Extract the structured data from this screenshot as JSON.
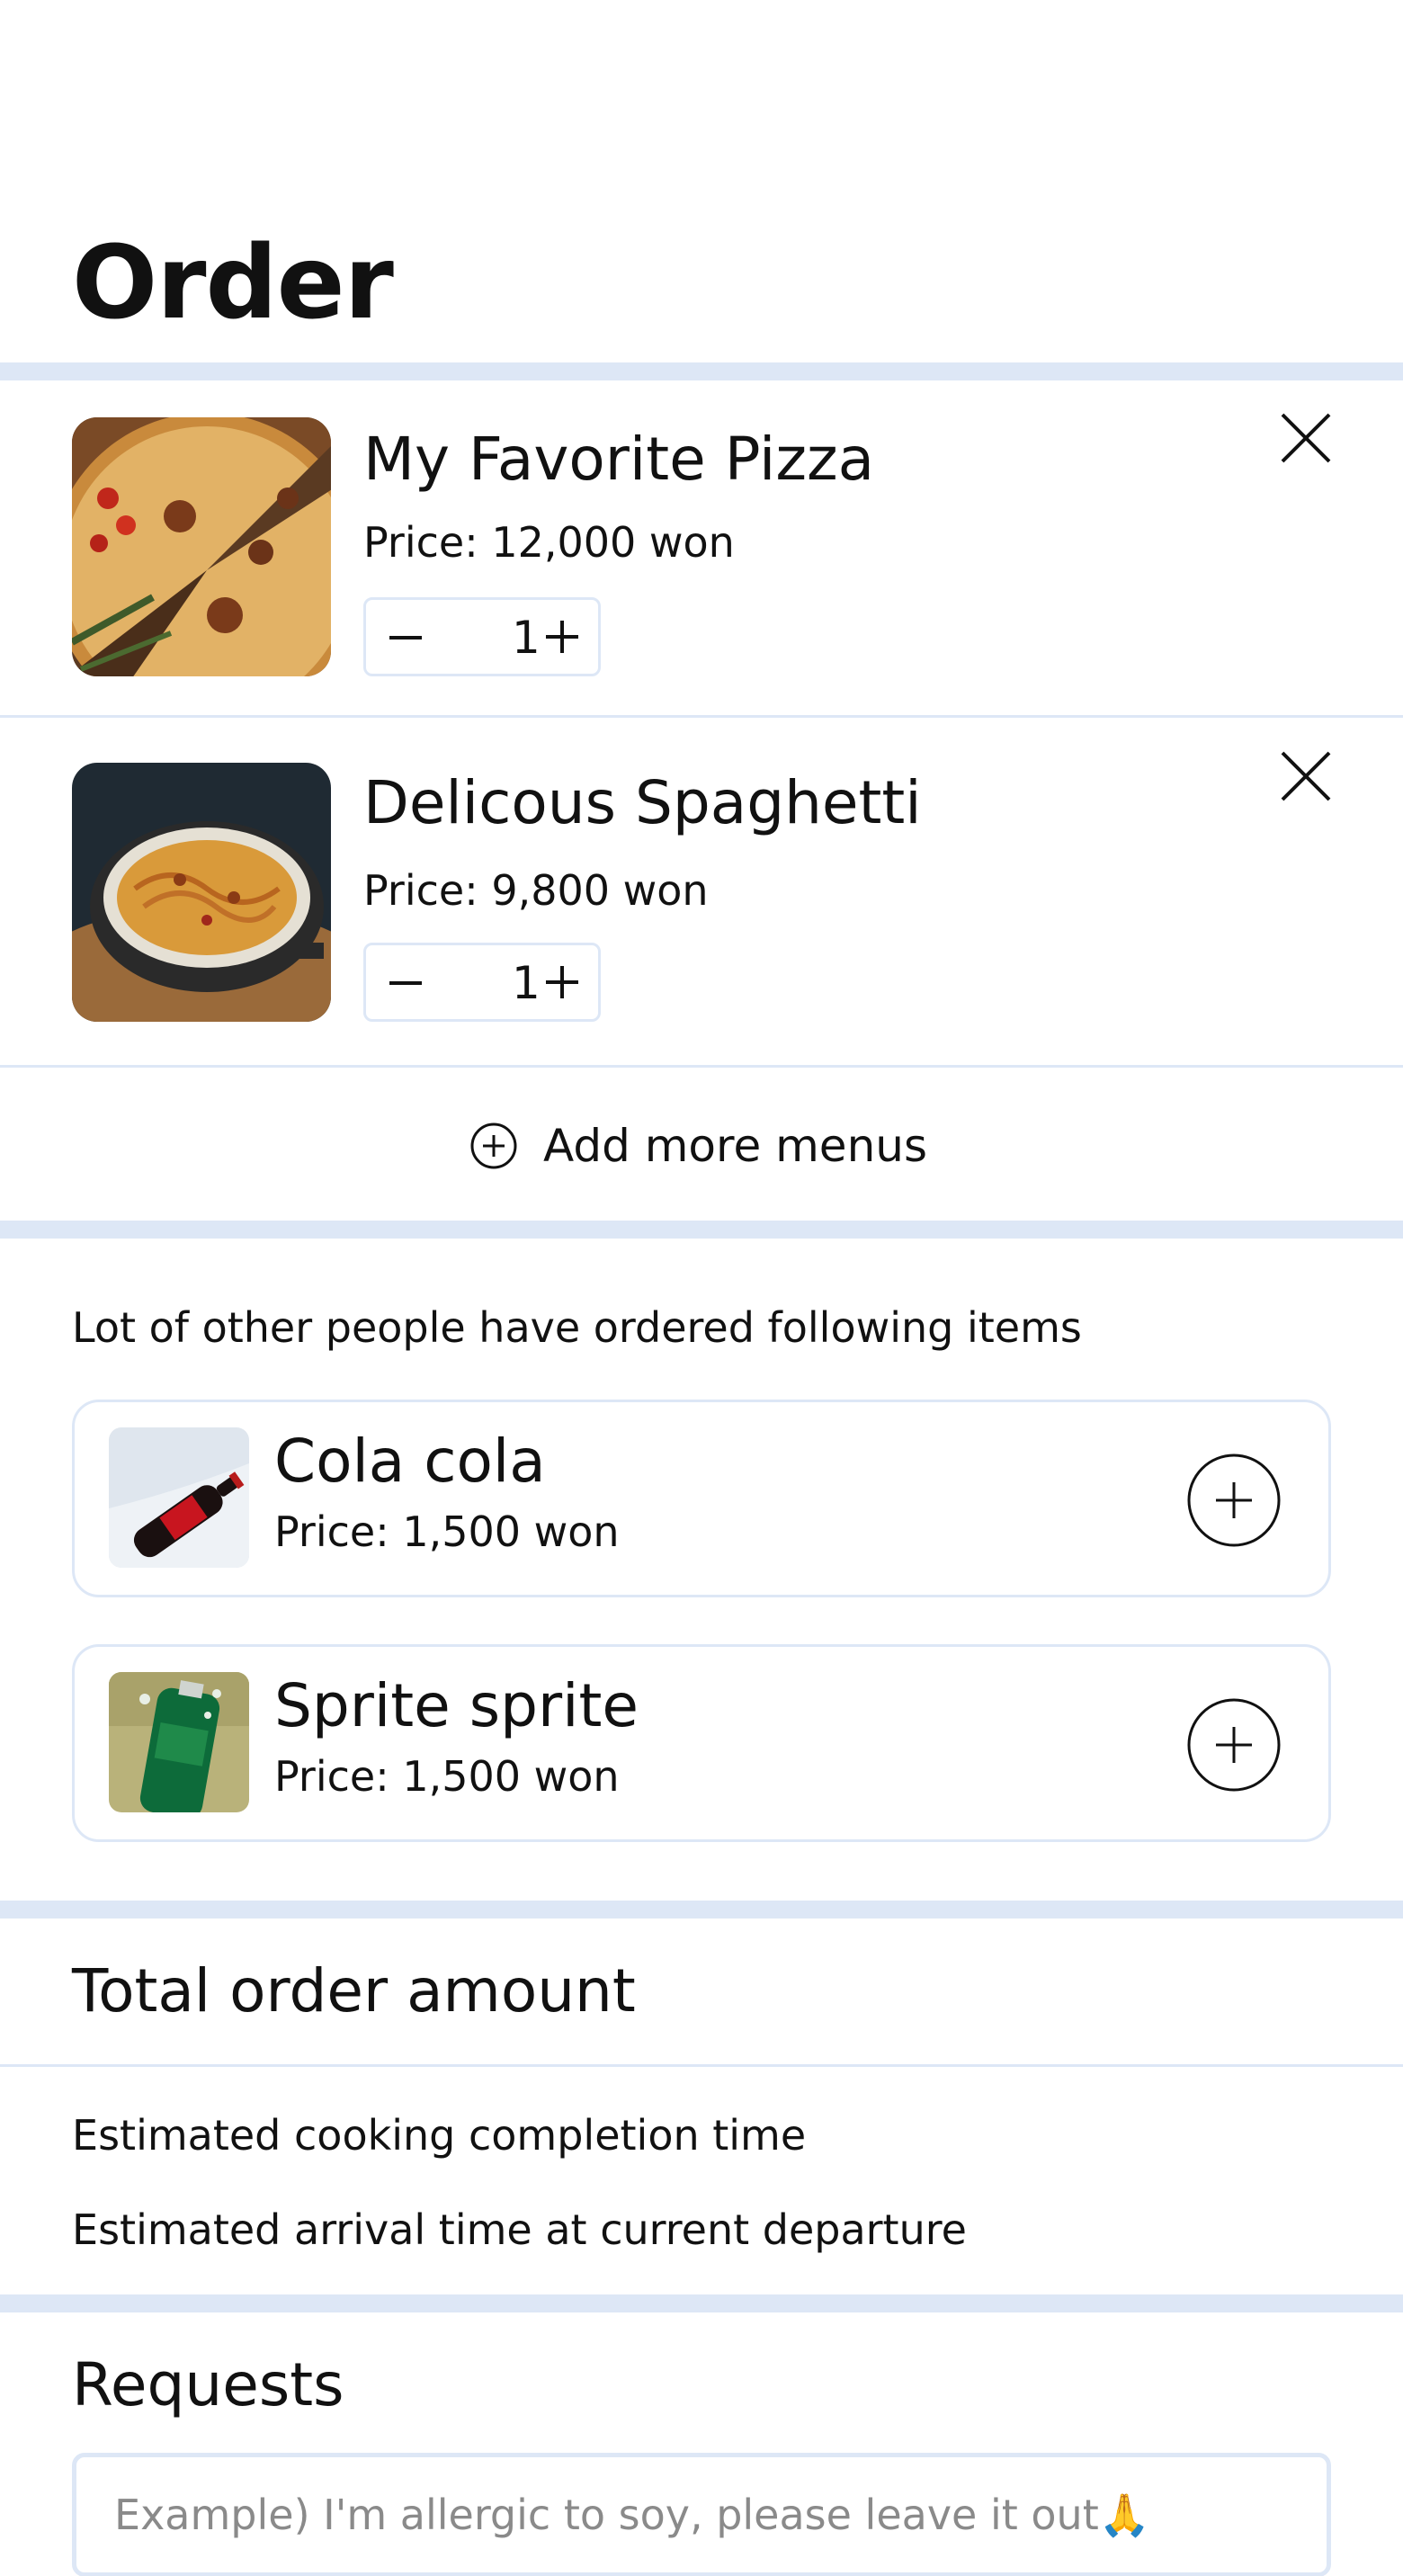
{
  "page": {
    "title": "Order"
  },
  "cart": {
    "items": [
      {
        "name": "My Favorite Pizza",
        "price": "Price: 12,000 won",
        "quantity": "1"
      },
      {
        "name": "Delicous Spaghetti",
        "price": "Price: 9,800 won",
        "quantity": "1"
      }
    ],
    "add_more_label": "Add more menus"
  },
  "recommendations": {
    "heading": "Lot of other people have ordered following items",
    "items": [
      {
        "name": "Cola cola",
        "price": "Price: 1,500 won"
      },
      {
        "name": "Sprite sprite",
        "price": "Price: 1,500 won"
      }
    ]
  },
  "summary": {
    "total_label": "Total order amount",
    "cooking_time_label": "Estimated cooking completion time",
    "arrival_time_label": "Estimated arrival time at current departure"
  },
  "requests": {
    "heading": "Requests",
    "placeholder": "Example) I'm allergic to soy, please leave it out🙏"
  },
  "colors": {
    "separator": "#dde7f6",
    "text": "#111111",
    "placeholder": "#8a8a8a"
  },
  "icons": [
    "close-icon",
    "minus-icon",
    "plus-icon",
    "add-circle-icon"
  ]
}
